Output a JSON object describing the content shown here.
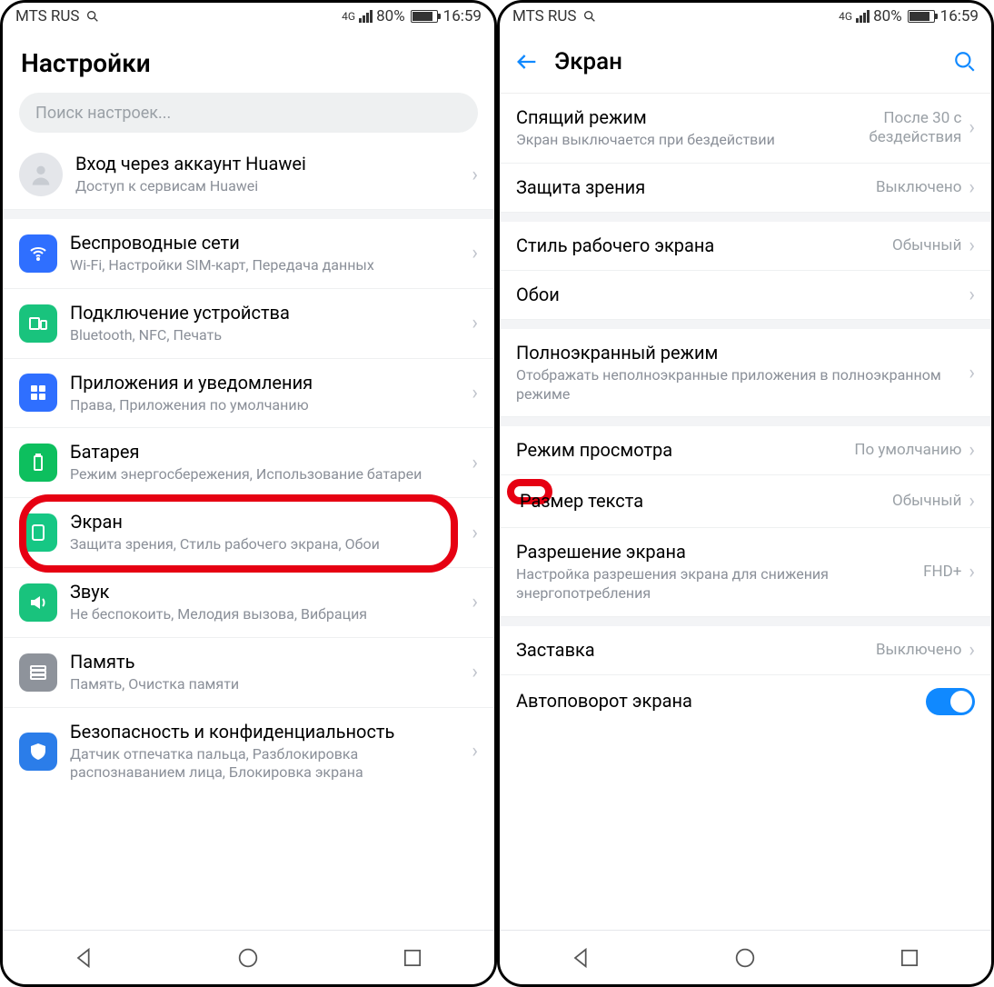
{
  "status": {
    "carrier": "MTS RUS",
    "network": "4G",
    "battery_pct": "80%",
    "time": "16:59"
  },
  "left": {
    "header": "Настройки",
    "search_placeholder": "Поиск настроек...",
    "account": {
      "label": "Вход через аккаунт Huawei",
      "sub": "Доступ к сервисам Huawei"
    },
    "items": [
      {
        "label": "Беспроводные сети",
        "sub": "Wi-Fi, Настройки SIM-карт, Передача данных"
      },
      {
        "label": "Подключение устройства",
        "sub": "Bluetooth, NFC, Печать"
      },
      {
        "label": "Приложения и уведомления",
        "sub": "Права, Приложения по умолчанию"
      },
      {
        "label": "Батарея",
        "sub": "Режим энергосбережения, Использование батареи"
      },
      {
        "label": "Экран",
        "sub": "Защита зрения, Стиль рабочего экрана, Обои"
      },
      {
        "label": "Звук",
        "sub": "Не беспокоить, Мелодия вызова, Вибрация"
      },
      {
        "label": "Память",
        "sub": "Память, Очистка памяти"
      },
      {
        "label": "Безопасность и конфиденциальность",
        "sub": "Датчик отпечатка пальца, Разблокировка распознаванием лица, Блокировка экрана"
      }
    ]
  },
  "right": {
    "header": "Экран",
    "groups": [
      [
        {
          "label": "Спящий режим",
          "sub": "Экран выключается при бездействии",
          "value": "После 30 с бездействия"
        },
        {
          "label": "Защита зрения",
          "value": "Выключено"
        }
      ],
      [
        {
          "label": "Стиль рабочего экрана",
          "value": "Обычный"
        },
        {
          "label": "Обои",
          "value": ""
        }
      ],
      [
        {
          "label": "Полноэкранный режим",
          "sub": "Отображать неполноэкранные приложения в полноэкранном режиме"
        }
      ],
      [
        {
          "label": "Режим просмотра",
          "value": "По умолчанию"
        },
        {
          "label": "Размер текста",
          "value": "Обычный"
        },
        {
          "label": "Разрешение экрана",
          "sub": "Настройка разрешения экрана для снижения энергопотребления",
          "value": "FHD+"
        }
      ],
      [
        {
          "label": "Заставка",
          "value": "Выключено"
        },
        {
          "label": "Автоповорот экрана",
          "toggle": true
        }
      ]
    ]
  }
}
